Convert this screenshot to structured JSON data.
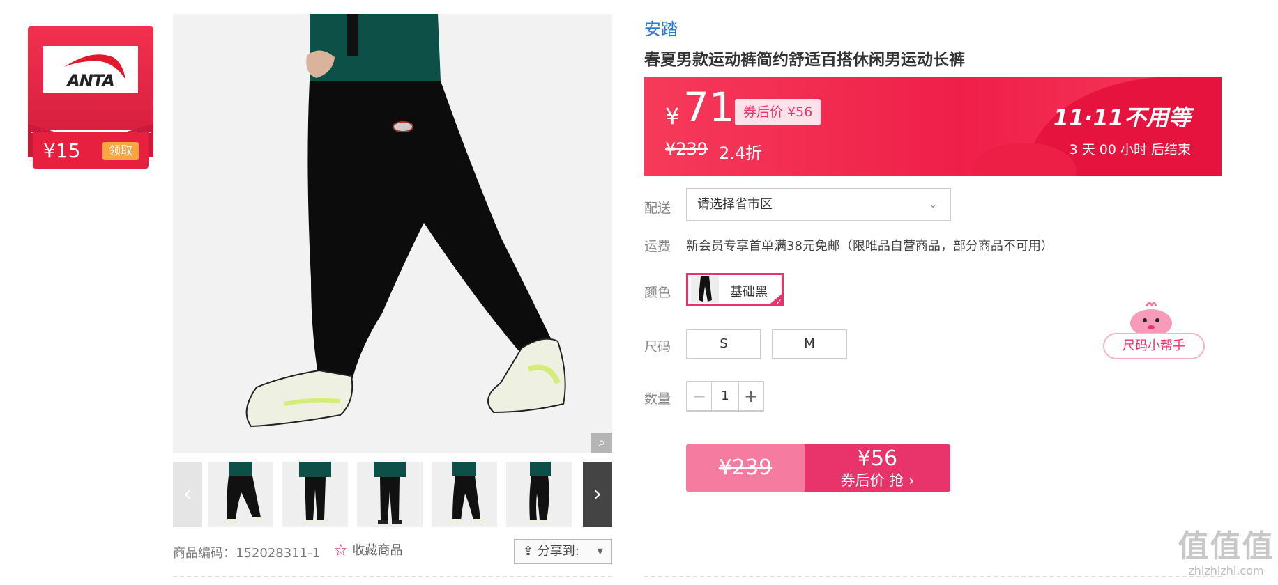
{
  "coupon": {
    "logo_text": "ANTA",
    "amount": "¥15",
    "claim_label": "领取"
  },
  "gallery": {
    "zoom_icon": "magnifier-icon",
    "prev_icon": "chevron-left-icon",
    "next_icon": "chevron-right-icon",
    "prev_label": "‹",
    "next_label": "›",
    "thumbnail_count": 5
  },
  "meta": {
    "sku_label": "商品编码：152028311-1",
    "favorite_label": "收藏商品",
    "share_label": "分享到:"
  },
  "product": {
    "brand": "安踏",
    "title": "春夏男款运动裤简约舒适百搭休闲男运动长裤"
  },
  "price": {
    "currency": "¥",
    "current": "71",
    "after_coupon": "券后价 ¥56",
    "original": "¥239",
    "discount": "2.4折",
    "promo_title": "11·11不用等",
    "countdown": "3  天  00  小时 后结束",
    "accent_color": "#ef1f49"
  },
  "delivery": {
    "label": "配送",
    "placeholder": "请选择省市区"
  },
  "shipping": {
    "label": "运费",
    "text": "新会员专享首单满38元免邮（限唯品自营商品，部分商品不可用）"
  },
  "color": {
    "label": "颜色",
    "selected": "基础黑"
  },
  "size": {
    "label": "尺码",
    "options": [
      "S",
      "M"
    ],
    "helper_label": "尺码小帮手"
  },
  "quantity": {
    "label": "数量",
    "minus": "−",
    "value": "1",
    "plus": "+"
  },
  "buy": {
    "original_price": "¥239",
    "coupon_price": "¥56",
    "cta_label": "券后价 抢 ›",
    "button_color": "#e9336b"
  },
  "watermark": {
    "mark": "值值值",
    "domain": "zhizhizhi.com"
  }
}
